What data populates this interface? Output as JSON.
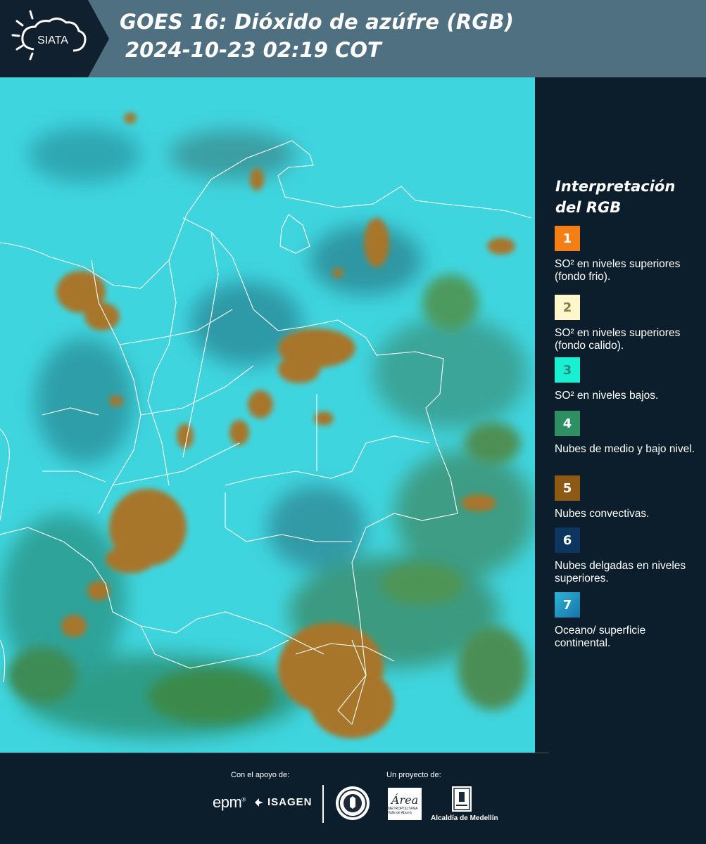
{
  "header": {
    "logo_text": "SIATA",
    "title_line1": "GOES 16: Dióxido de azúfre (RGB)",
    "title_line2": "2024-10-23 02:19 COT"
  },
  "map": {
    "region": "Colombia",
    "layer": "SO2 RGB",
    "base_color": "#3fd6df"
  },
  "legend": {
    "title": "Interpretación del RGB",
    "items": [
      {
        "number": "1",
        "color": "#f57f17",
        "text": "SO² en niveles superiores (fondo frio)."
      },
      {
        "number": "2",
        "color": "#fff6c9",
        "text": "SO² en niveles superiores (fondo calido)."
      },
      {
        "number": "3",
        "color": "#19f0d2",
        "text": "SO² en niveles bajos."
      },
      {
        "number": "4",
        "color": "#2e8f63",
        "text": "Nubes de medio y bajo nivel."
      },
      {
        "number": "5",
        "color": "#8c5a12",
        "text": "Nubes convectivas."
      },
      {
        "number": "6",
        "color": "#0c3560",
        "text": "Nubes delgadas en niveles superiores."
      },
      {
        "number": "7",
        "color": "#1e8ebf",
        "text": "Oceano/ superficie continental."
      }
    ]
  },
  "footer": {
    "support_label": "Con el apoyo de:",
    "project_label": "Un proyecto de:",
    "support_logos": [
      "epm",
      "ISAGEN"
    ],
    "project_logos": [
      "Área Metropolitana Valle de Aburrá",
      "Alcaldía de Medellín"
    ],
    "area_logo_text": "Área",
    "area_logo_sub": "METROPOLITANA Valle de Aburrá",
    "alcaldia_text": "Alcaldía de Medellín",
    "epm_text": "epm",
    "isagen_text": "ISAGEN"
  }
}
